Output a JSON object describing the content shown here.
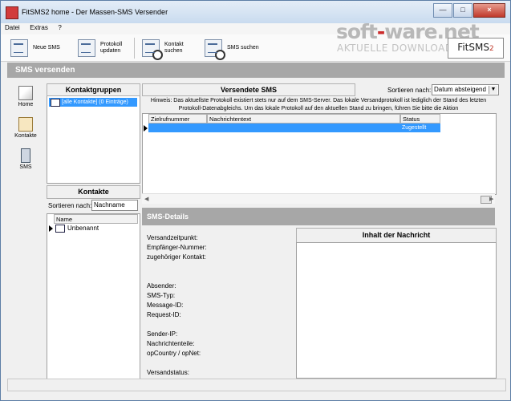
{
  "window": {
    "title": "FitSMS2 home - Der Massen-SMS Versender",
    "controls": [
      "minimize",
      "maximize",
      "close"
    ]
  },
  "menu": [
    "Datei",
    "Extras",
    "?"
  ],
  "toolbar": [
    {
      "label": "Neue SMS",
      "icon": "new-sms-icon"
    },
    {
      "label": "Protokoll updaten",
      "icon": "protocol-update-icon"
    },
    {
      "label": "Kontakt suchen",
      "icon": "contact-search-icon"
    },
    {
      "label": "SMS suchen",
      "icon": "sms-search-icon"
    }
  ],
  "watermark": {
    "line1a": "soft",
    "dot": "-",
    "line1b": "ware.net",
    "line2": "AKTUELLE DOWNLOADS"
  },
  "logo": {
    "text": "FitSMS",
    "suffix": "2"
  },
  "section_title": "SMS versenden",
  "nav": [
    {
      "label": "Home",
      "icon": "home-icon"
    },
    {
      "label": "Kontakte",
      "icon": "contacts-icon"
    },
    {
      "label": "SMS",
      "icon": "sms-icon"
    }
  ],
  "groups": {
    "title": "Kontaktgruppen",
    "items": [
      "[alle Kontakte] (0 Einträge)"
    ]
  },
  "contacts": {
    "title": "Kontakte",
    "sort_label": "Sortieren nach:",
    "sort_value": "Nachname",
    "column": "Name",
    "rows": [
      "Unbenannt"
    ]
  },
  "sent": {
    "title": "Versendete SMS",
    "sort_label": "Sortieren nach:",
    "sort_value": "Datum absteigend",
    "hint": "Hinweis: Das aktuellste Protokoll existiert stets nur auf dem SMS-Server. Das lokale Versandprotokoll ist lediglich der Stand des letzten Protokoll-Datenabgleichs. Um das lokale Protokoll auf den aktuellen Stand zu bringen, führen Sie bitte die Aktion",
    "columns": [
      "Zielrufnummer",
      "Nachrichtentext",
      "Status"
    ],
    "rows": [
      {
        "number": "",
        "text": "",
        "status": "Zugestellt"
      }
    ]
  },
  "details": {
    "title": "SMS-Details",
    "content_title": "Inhalt der Nachricht",
    "fields": [
      "Versandzeitpunkt:",
      "Empfänger-Nummer:",
      "zugehöriger Kontakt:",
      "",
      "",
      "Absender:",
      "SMS-Typ:",
      "Message-ID:",
      "Request-ID:",
      "",
      "Sender-IP:",
      "Nachrichtenteile:",
      "opCountry / opNet:",
      "",
      "Versandstatus:"
    ]
  }
}
